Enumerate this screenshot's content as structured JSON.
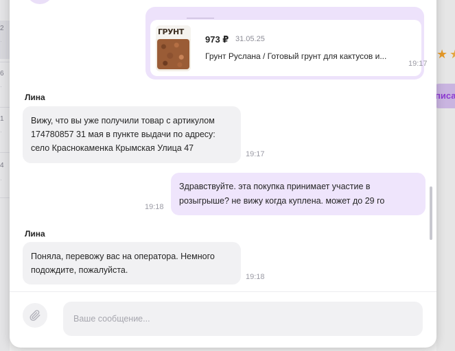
{
  "background_left": {
    "numbers": [
      "2",
      "6",
      "1",
      "4"
    ]
  },
  "background_right": {
    "pill_text": "писа"
  },
  "product": {
    "thumb_brand": "ГРУНТ",
    "price": "973 ₽",
    "date": "31.05.25",
    "title": "Грунт Руслана / Готовый грунт для кактусов и...",
    "time": "19:17"
  },
  "messages": [
    {
      "sender": "Лина",
      "lines": [
        "Вижу, что вы уже получили товар с артикулом",
        "174780857 31 мая в пункте выдачи по адресу:",
        "село Краснокаменка Крымская Улица 47"
      ],
      "time": "19:17"
    },
    {
      "lines": [
        "Здравствуйте. эта покупка принимает участие в",
        "розыгрыше? не вижу когда куплена. может до 29 го"
      ],
      "time": "19:18"
    },
    {
      "sender": "Лина",
      "lines": [
        "Поняла, перевожу вас на оператора. Немного",
        "подождите, пожалуйста."
      ],
      "time": "19:18"
    }
  ],
  "composer": {
    "placeholder": "Ваше сообщение..."
  },
  "colors": {
    "accent": "#8e3bd1",
    "outgoing_bubble": "#efe5fc",
    "incoming_bubble": "#f1f1f3"
  },
  "icons": {
    "attach": "paperclip-icon",
    "rating": "star-icon"
  }
}
